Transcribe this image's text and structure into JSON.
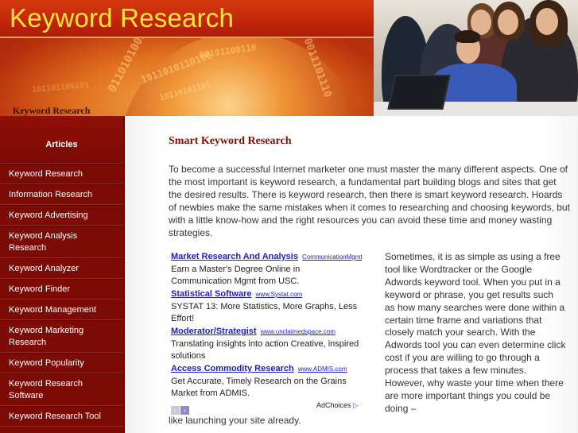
{
  "header": {
    "site_title": "Keyword Research",
    "banner_label": "Keyword Research",
    "binary_rows": [
      "0110101001",
      "1011010110100",
      "00101100110",
      "10110101101",
      "0011101110",
      "101101100101"
    ]
  },
  "sidebar": {
    "heading": "Articles",
    "items": [
      {
        "label": "Keyword Research"
      },
      {
        "label": "Information Research"
      },
      {
        "label": "Keyword Advertising"
      },
      {
        "label": "Keyword Analysis Research"
      },
      {
        "label": "Keyword Analyzer"
      },
      {
        "label": "Keyword Finder"
      },
      {
        "label": "Keyword Management"
      },
      {
        "label": "Keyword Marketing Research"
      },
      {
        "label": "Keyword Popularity"
      },
      {
        "label": "Keyword Research Software"
      },
      {
        "label": "Keyword Research Tool"
      }
    ]
  },
  "article": {
    "title": "Smart Keyword Research",
    "intro": "To become a successful Internet marketer one must master the many different aspects. One of the most important is keyword research, a fundamental part building blogs and sites that get the desired results. There is keyword research, then there is smart keyword research. Hoards of newbies make the same mistakes when it comes to researching and choosing keywords, but with a little know-how and the right resources you can avoid these time and money wasting strategies.",
    "side_text": "Sometimes, it is as simple as using a free tool like Wordtracker or the Google Adwords keyword tool. When you put in a keyword or phrase, you get results such as how many searches were done within a certain time frame and variations that closely match your search. With the Adwords tool you can even determine click cost if you are willing to go through a process that takes a few minutes. However, why waste your time when there are more important things you could be doing –",
    "continue_text": "like launching your site already."
  },
  "ads": {
    "items": [
      {
        "title": "Market Research And Analysis",
        "url": "CommunicationMgmt.USC.edu",
        "desc": "Earn a Master's Degree Online in Communication Mgmt from USC."
      },
      {
        "title": "Statistical Software",
        "url": "www.Systat.com",
        "desc": "SYSTAT 13: More Statistics, More Graphs, Less Effort!"
      },
      {
        "title": "Moderator/Strategist",
        "url": "www.unclaimedspace.com",
        "desc": "Translating insights into action Creative, inspired solutions"
      },
      {
        "title": "Access Commodity Research",
        "url": "www.ADMIS.com",
        "desc": "Get Accurate, Timely Research on the Grains Market from ADMIS."
      }
    ],
    "prev_glyph": "‹",
    "next_glyph": "›",
    "adchoices_label": "AdChoices",
    "adchoices_glyph": "▷"
  },
  "colors": {
    "sidebar_bg": "#7c0b06",
    "title_yellow": "#ffe43a",
    "heading_red": "#7a0f05",
    "ad_link": "#1e1ec8"
  }
}
